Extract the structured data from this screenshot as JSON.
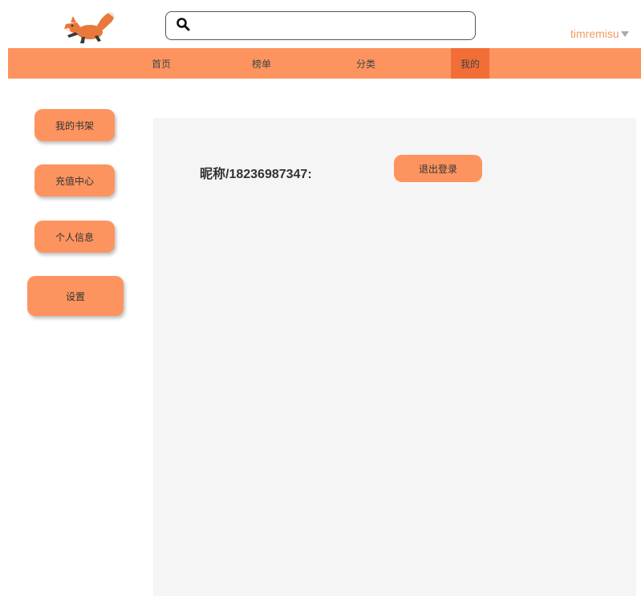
{
  "header": {
    "logo_icon": "fox-logo-icon",
    "search": {
      "value": "",
      "placeholder": "",
      "icon": "search-icon"
    },
    "username": "timremisu",
    "user_caret_icon": "caret-down-icon"
  },
  "nav": {
    "items": [
      {
        "label": "首页"
      },
      {
        "label": "榜单"
      },
      {
        "label": "分类"
      },
      {
        "label": "我的",
        "active": true
      }
    ]
  },
  "sidebar": {
    "items": [
      {
        "label": "我的书架"
      },
      {
        "label": "充值中心"
      },
      {
        "label": "个人信息"
      },
      {
        "label": "设置"
      }
    ]
  },
  "main": {
    "nickname": "昵称/18236987347:",
    "logout_label": "退出登录"
  },
  "colors": {
    "accent": "#fd9460",
    "accent_active": "#f36e36",
    "username": "#f29a66",
    "panel_bg": "#f5f5f5"
  }
}
